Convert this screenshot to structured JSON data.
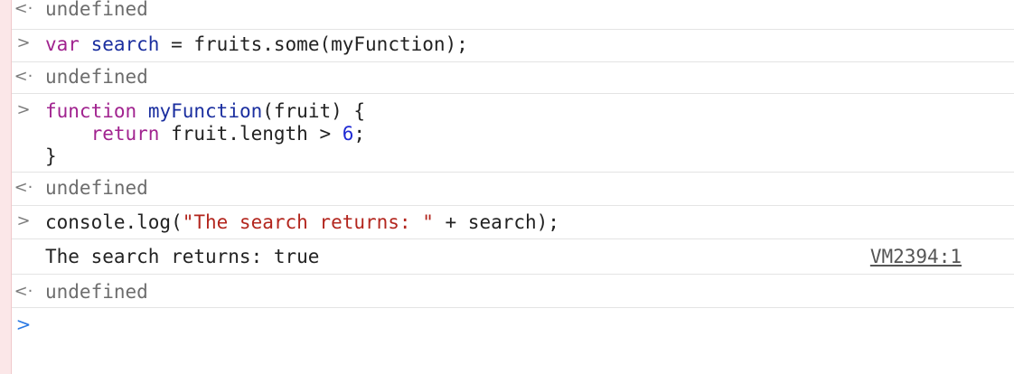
{
  "gutter": {
    "result_glyph": "<·",
    "input_glyph": ">",
    "prompt_glyph": ">"
  },
  "colors": {
    "keyword": "#a1238f",
    "definition": "#1a2e9f",
    "number": "#1f2ad4",
    "string": "#b3261e",
    "result_text": "#6d6d6d",
    "prompt": "#2a79e4"
  },
  "entries": {
    "result_1": "undefined",
    "input_1": {
      "kw": "var",
      "name": "search",
      "rest": " = fruits.some(myFunction);"
    },
    "result_2": "undefined",
    "input_2": {
      "line1_kw": "function",
      "line1_name": "myFunction",
      "line1_rest": "(fruit) {",
      "line2_indent": "    ",
      "line2_kw": "return",
      "line2_rest": " fruit.length > ",
      "line2_num": "6",
      "line2_end": ";",
      "line3": "}"
    },
    "result_3": "undefined",
    "input_3": {
      "call": "console.log(",
      "string": "\"The search returns: \"",
      "rest": " + search);"
    },
    "log_output": {
      "text": "The search returns: true",
      "source": "VM2394:1"
    },
    "result_4": "undefined"
  }
}
